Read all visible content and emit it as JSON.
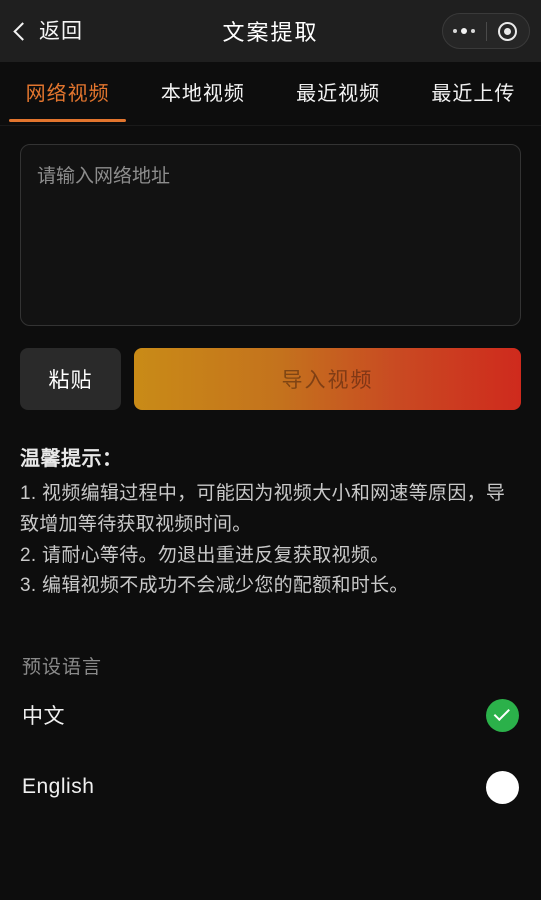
{
  "header": {
    "back_label": "返回",
    "title": "文案提取",
    "capsule": {
      "menu_icon": "more-dots-icon",
      "target_icon": "target-circle-icon"
    }
  },
  "tabs": [
    {
      "label": "网络视频",
      "active": true
    },
    {
      "label": "本地视频",
      "active": false
    },
    {
      "label": "最近视频",
      "active": false
    },
    {
      "label": "最近上传",
      "active": false
    }
  ],
  "form": {
    "url_placeholder": "请输入网络地址",
    "url_value": "",
    "paste_label": "粘贴",
    "import_label": "导入视频"
  },
  "tips": {
    "title": "温馨提示：",
    "items": [
      "1. 视频编辑过程中，可能因为视频大小和网速等原因，导致增加等待获取视频时间。",
      "2. 请耐心等待。勿退出重进反复获取视频。",
      "3. 编辑视频不成功不会减少您的配额和时长。"
    ]
  },
  "language": {
    "section_title": "预设语言",
    "options": [
      {
        "label": "中文",
        "selected": true
      },
      {
        "label": "English",
        "selected": false
      }
    ]
  },
  "colors": {
    "accent_orange": "#e2752e",
    "gradient_start": "#c98b17",
    "gradient_end": "#cf2a1d",
    "selected_green": "#2bb14a",
    "page_background": "#0d0d0d",
    "navbar_background": "#1f1f1f"
  }
}
